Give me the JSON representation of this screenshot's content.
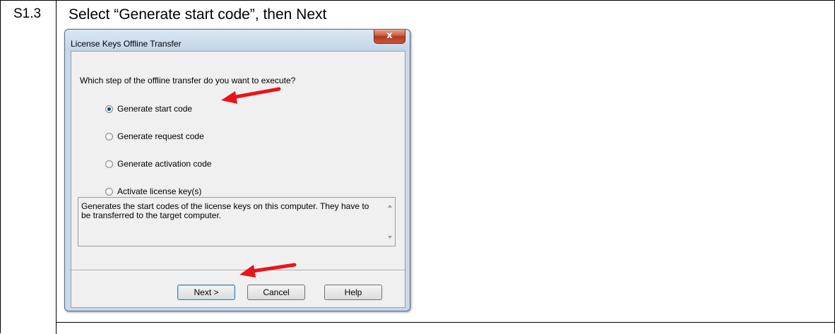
{
  "step": {
    "id": "S1.3",
    "instruction": "Select “Generate start code”, then Next"
  },
  "dialog": {
    "title": "License Keys Offline Transfer",
    "close_label": "x",
    "question": "Which step of the offline transfer do you want to execute?",
    "options": [
      {
        "label": "Generate start code",
        "checked": true
      },
      {
        "label": "Generate request code",
        "checked": false
      },
      {
        "label": "Generate activation code",
        "checked": false
      },
      {
        "label": "Activate license key(s)",
        "checked": false
      }
    ],
    "description": "Generates the start codes of the license keys on this computer. They have to be transferred to the target computer.",
    "buttons": {
      "next": "Next >",
      "cancel": "Cancel",
      "help": "Help"
    }
  },
  "colors": {
    "annotation_arrow": "#e8141a"
  }
}
